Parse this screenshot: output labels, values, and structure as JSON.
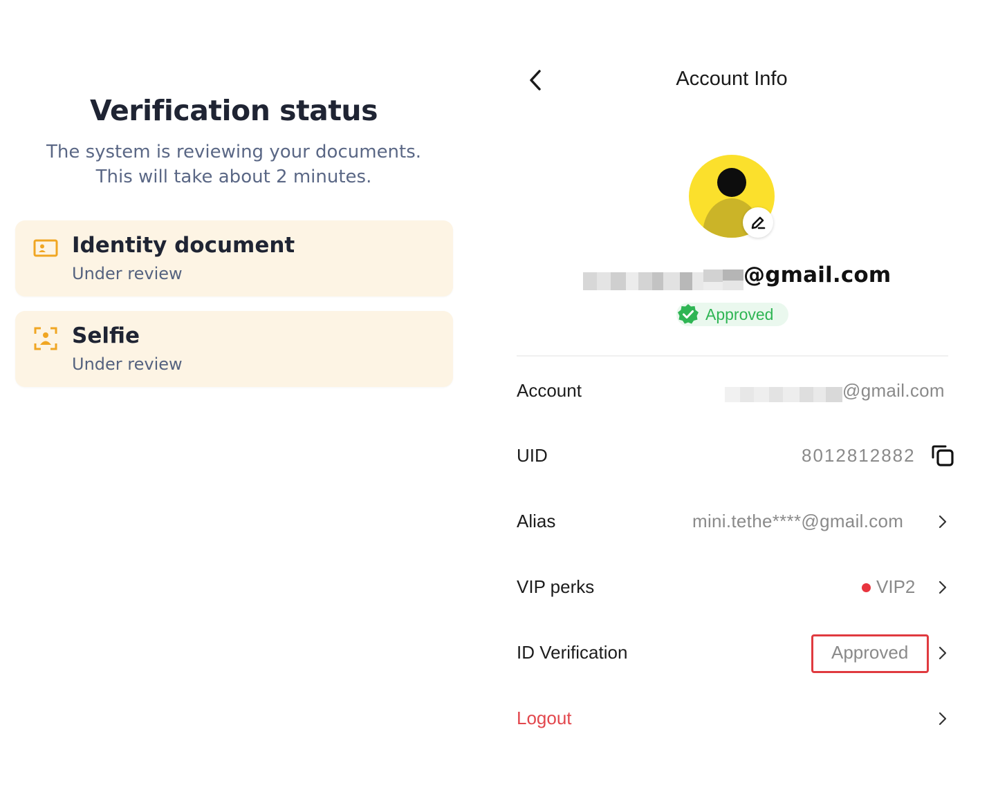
{
  "verification": {
    "title": "Verification status",
    "subtitle_line1": "The system is reviewing your documents.",
    "subtitle_line2": "This will take about 2 minutes.",
    "items": [
      {
        "title": "Identity document",
        "status": "Under review",
        "icon": "id-card-icon"
      },
      {
        "title": "Selfie",
        "status": "Under review",
        "icon": "face-scan-icon"
      }
    ],
    "accent_color": "#f0a623",
    "card_bg": "#fdf4e4"
  },
  "account_info": {
    "header_title": "Account Info",
    "back_icon": "chevron-left-icon",
    "avatar_color": "#fbe02c",
    "email_domain": "@gmail.com",
    "badge_label": "Approved",
    "badge_color": "#2fb554",
    "rows": {
      "account": {
        "label": "Account",
        "value": "@gmail.com"
      },
      "uid": {
        "label": "UID",
        "value": "8012812882",
        "icon": "copy-icon"
      },
      "alias": {
        "label": "Alias",
        "value": "mini.tethe****@gmail.com"
      },
      "vip": {
        "label": "VIP perks",
        "value": "VIP2",
        "dot_color": "#e8343e"
      },
      "id_verification": {
        "label": "ID Verification",
        "value": "Approved",
        "highlight_color": "#e03a3f"
      },
      "logout": {
        "label": "Logout",
        "color": "#e2474d"
      }
    }
  }
}
